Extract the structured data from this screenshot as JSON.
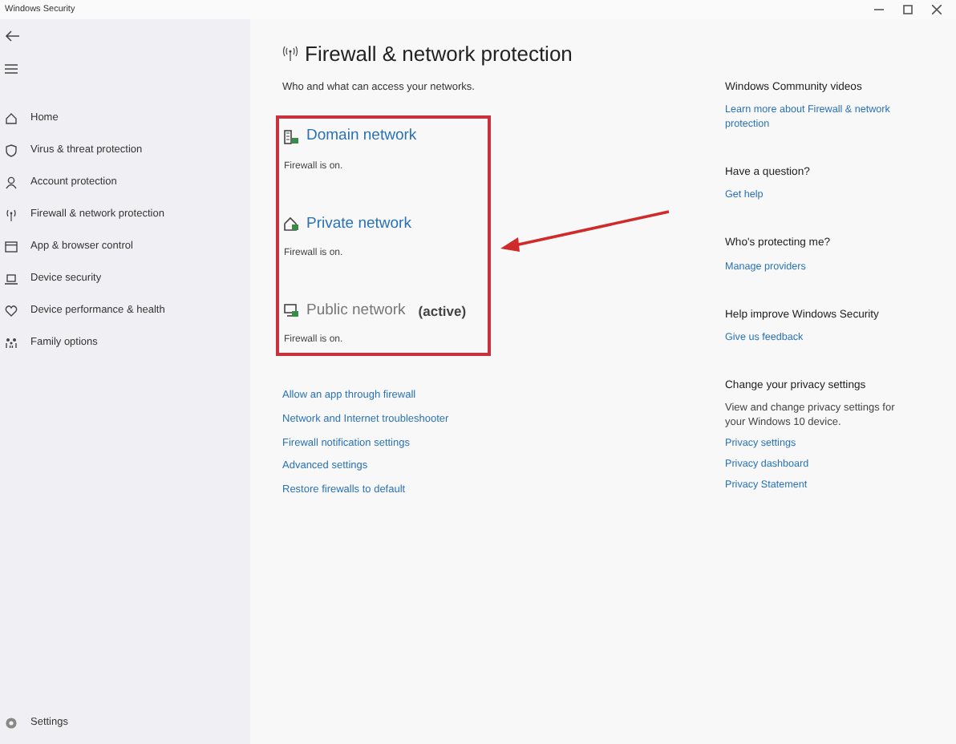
{
  "window": {
    "title": "Windows Security"
  },
  "sidebar": {
    "items": [
      {
        "label": "Home"
      },
      {
        "label": "Virus & threat protection"
      },
      {
        "label": "Account protection"
      },
      {
        "label": "Firewall & network protection"
      },
      {
        "label": "App & browser control"
      },
      {
        "label": "Device security"
      },
      {
        "label": "Device performance & health"
      },
      {
        "label": "Family options"
      }
    ],
    "settings": "Settings"
  },
  "page": {
    "title": "Firewall & network protection",
    "subtitle": "Who and what can access your networks.",
    "networks": [
      {
        "name": "Domain network",
        "status": "Firewall is on.",
        "active": false
      },
      {
        "name": "Private network",
        "status": "Firewall is on.",
        "active": false
      },
      {
        "name": "Public network",
        "active_label": "(active)",
        "status": "Firewall is on.",
        "active": true
      }
    ],
    "links": [
      "Allow an app through firewall",
      "Network and Internet troubleshooter",
      "Firewall notification settings",
      "Advanced settings",
      "Restore firewalls to default"
    ]
  },
  "side_panel": [
    {
      "heading": "Windows Community videos",
      "links": [
        "Learn more about Firewall & network protection"
      ]
    },
    {
      "heading": "Have a question?",
      "links": [
        "Get help"
      ]
    },
    {
      "heading": "Who's protecting me?",
      "links": [
        "Manage providers"
      ]
    },
    {
      "heading": "Help improve Windows Security",
      "links": [
        "Give us feedback"
      ]
    },
    {
      "heading": "Change your privacy settings",
      "text": "View and change privacy settings for your Windows 10 device.",
      "links": [
        "Privacy settings",
        "Privacy dashboard",
        "Privacy Statement"
      ]
    }
  ]
}
